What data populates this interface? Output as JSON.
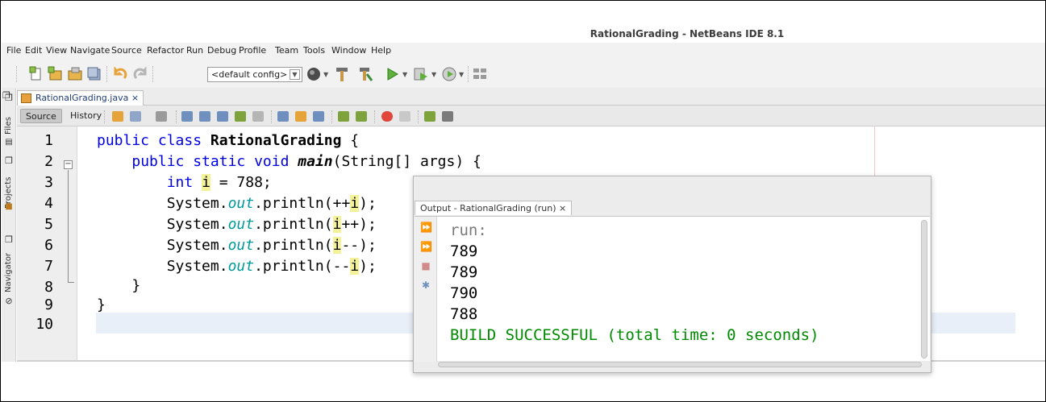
{
  "window": {
    "title": "RationalGrading - NetBeans IDE 8.1"
  },
  "menu": [
    {
      "label": "File"
    },
    {
      "label": "Edit"
    },
    {
      "label": "View"
    },
    {
      "label": "Navigate"
    },
    {
      "label": "Source"
    },
    {
      "label": "Refactor"
    },
    {
      "label": "Run"
    },
    {
      "label": "Debug"
    },
    {
      "label": "Profile"
    },
    {
      "label": "Team"
    },
    {
      "label": "Tools"
    },
    {
      "label": "Window"
    },
    {
      "label": "Help"
    }
  ],
  "toolbar": {
    "config_value": "<default config>"
  },
  "side_tabs": {
    "files": "Files",
    "projects": "Projects",
    "navigator": "Navigator"
  },
  "editor": {
    "tab_label": "RationalGrading.java",
    "tab_close": "×",
    "source_label": "Source",
    "history_label": "History",
    "line_numbers": [
      "1",
      "2",
      "3",
      "4",
      "5",
      "6",
      "7",
      "8",
      "9",
      "10"
    ]
  },
  "output": {
    "tab_label": "Output - RationalGrading (run)",
    "tab_close": "×",
    "lines": [
      "run:",
      "789",
      "789",
      "790",
      "788",
      "BUILD SUCCESSFUL (total time: 0 seconds)"
    ],
    "colors": {
      "run": "#7a7a7a",
      "value": "#000000",
      "success": "#008a00"
    }
  },
  "icons": [
    "new-file-icon",
    "new-project-icon",
    "open-project-icon",
    "save-all-icon",
    "undo-icon",
    "redo-icon",
    "globe-icon",
    "hammer-icon",
    "clean-build-icon",
    "run-icon",
    "debug-icon",
    "profile-icon",
    "grid-icon"
  ]
}
